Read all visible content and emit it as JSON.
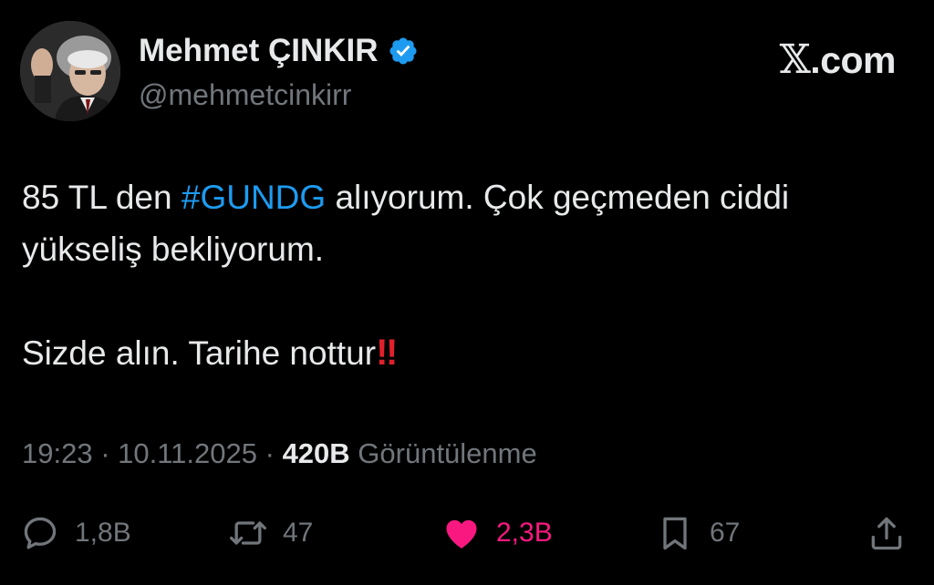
{
  "profile": {
    "display_name": "Mehmet ÇINKIR",
    "handle": "@mehmetcinkirr",
    "verified": true
  },
  "brand": {
    "x_mark": "𝕏",
    "domain": ".com"
  },
  "tweet": {
    "line1_pre": "85 TL den ",
    "hashtag": "#GUNDG",
    "line1_post": " alıyorum. Çok geçmeden ciddi yükseliş bekliyorum.",
    "line2": "Sizde alın. Tarihe nottur",
    "line2_emoji": "‼"
  },
  "meta": {
    "time": "19:23",
    "sep1": " · ",
    "date": "10.11.2025",
    "sep2": " · ",
    "views": "420B",
    "views_label": " Görüntülenme"
  },
  "actions": {
    "reply": "1,8B",
    "retweet": "47",
    "like": "2,3B",
    "bookmark": "67"
  },
  "colors": {
    "background": "#000000",
    "text": "#e7e9ea",
    "muted": "#71767b",
    "link": "#1d9bf0",
    "like": "#f91880",
    "emoji": "#e0202b"
  },
  "icons": {
    "verified": "verified-badge-icon",
    "reply": "reply-icon",
    "retweet": "retweet-icon",
    "like": "heart-icon",
    "bookmark": "bookmark-icon",
    "share": "share-icon"
  }
}
